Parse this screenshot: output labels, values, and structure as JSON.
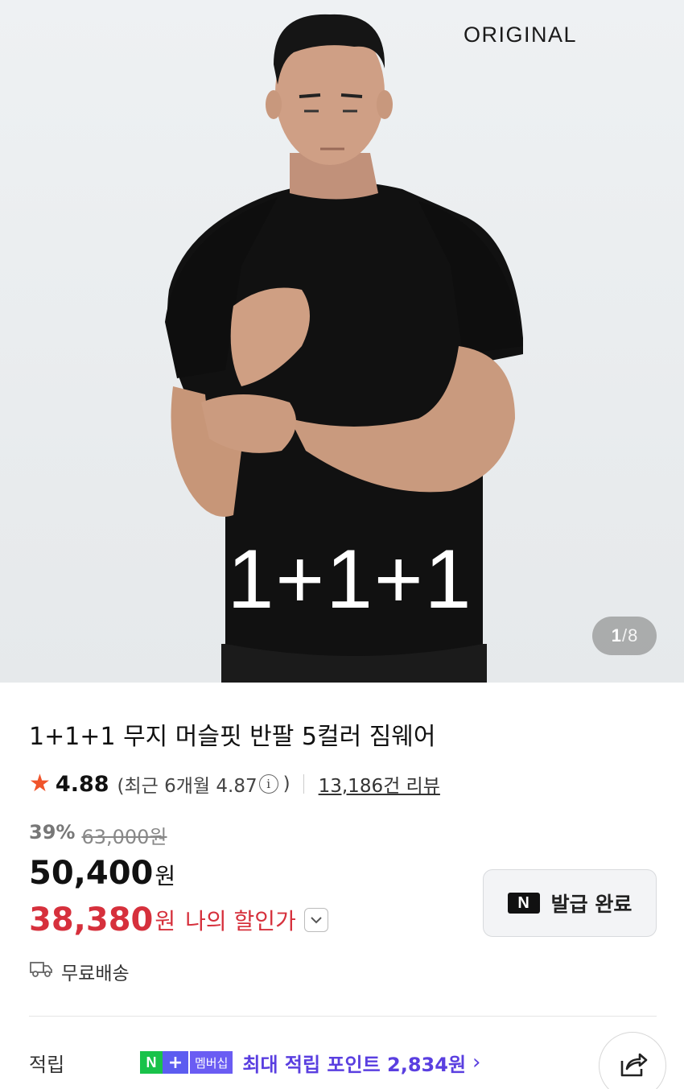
{
  "hero": {
    "brand": "ORIGINAL",
    "promo_overlay": "1+1+1",
    "pager": {
      "current": "1",
      "separator": "/",
      "total": "8"
    }
  },
  "product": {
    "title": "1+1+1 무지 머슬핏 반팔 5컬러 짐웨어",
    "rating": {
      "score": "4.88",
      "recent_open": "(최근 6개월 4.87",
      "recent_close": ")",
      "review_count": "13,186건 리뷰"
    },
    "price": {
      "discount_rate": "39%",
      "original": "63,000원",
      "sale_amount": "50,400",
      "sale_unit": "원",
      "my_amount": "38,380",
      "my_unit": "원",
      "my_label": "나의 할인가"
    },
    "coupon": {
      "label": "발급 완료",
      "logo": "N"
    },
    "shipping": "무료배송",
    "points": {
      "label": "적립",
      "badge_n": "N",
      "badge_plus": "+",
      "badge_membership": "멤버십",
      "text": "최대 적립 포인트 2,834원"
    }
  },
  "colors": {
    "accent_red": "#d6303c",
    "star": "#f0542b",
    "points_purple": "#5a3fe0",
    "naver_green": "#19c24a"
  },
  "icons": {
    "star": "star-icon",
    "info": "info-icon",
    "chevron": "chevron-down-icon",
    "truck": "truck-icon",
    "share": "share-icon",
    "arrow": "chevron-right-icon"
  }
}
